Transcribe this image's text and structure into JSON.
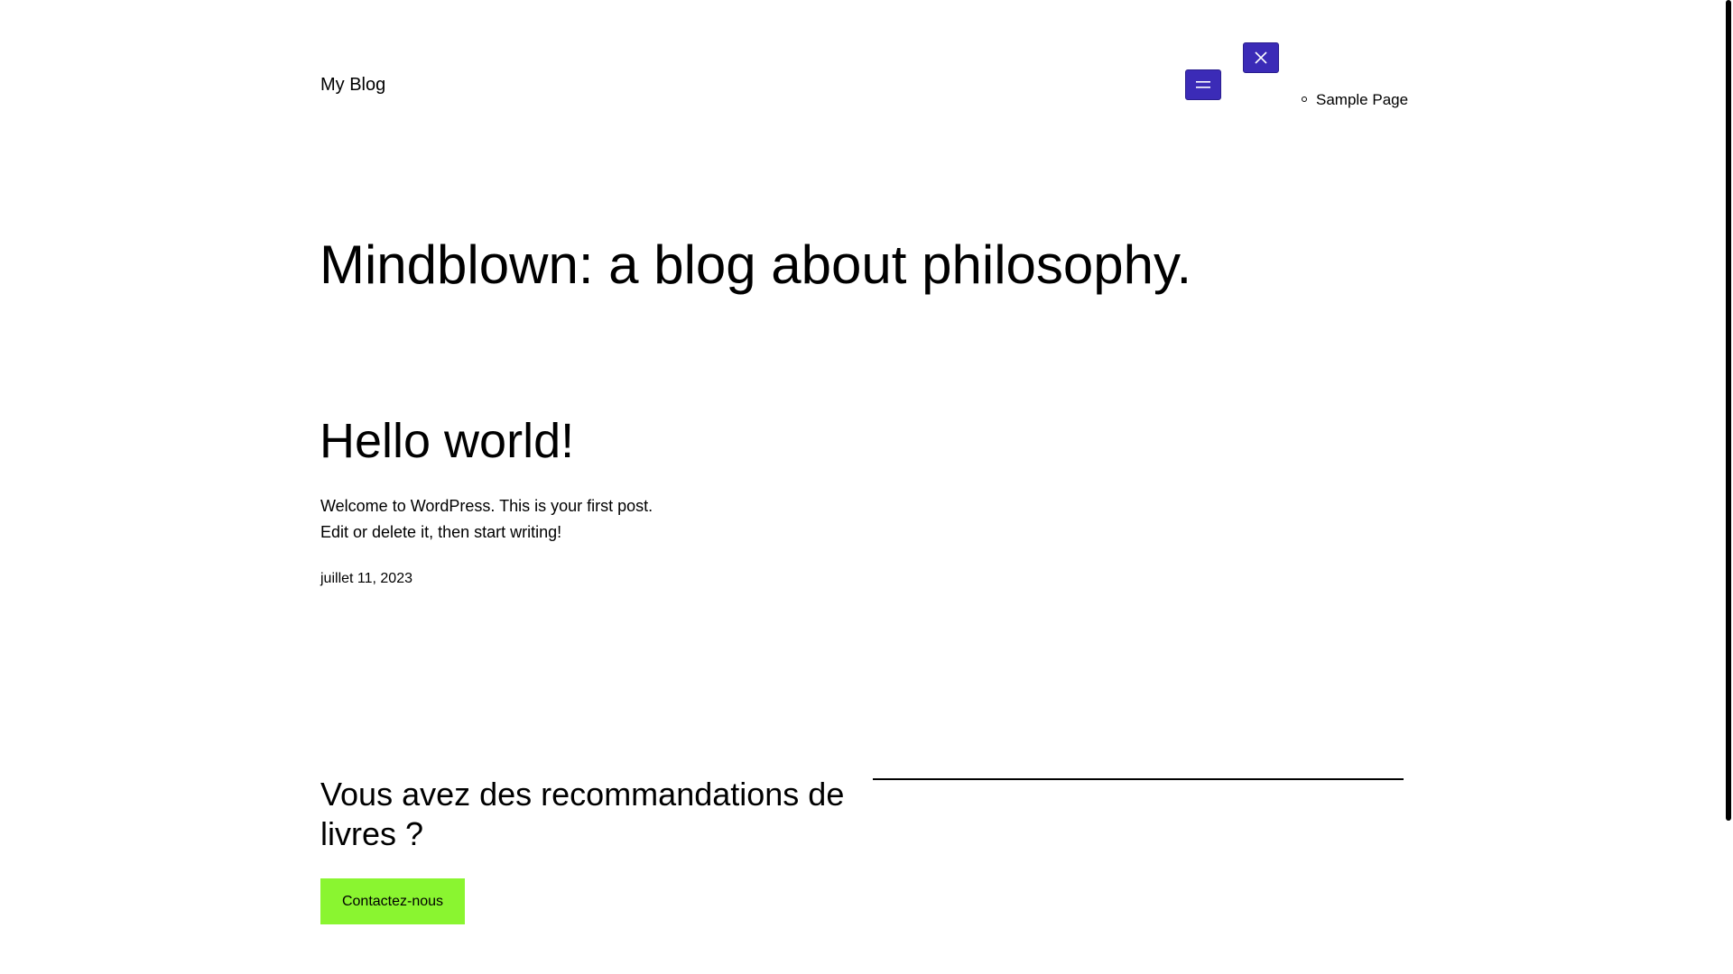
{
  "header": {
    "site_title": "My Blog",
    "menu_open_icon": "hamburger-icon",
    "menu_close_icon": "close-icon",
    "nav_items": [
      {
        "label": "Sample Page"
      }
    ]
  },
  "hero": {
    "title": "Mindblown: a blog about philosophy."
  },
  "post": {
    "title": "Hello world!",
    "excerpt_line1": "Welcome to WordPress. This is your first post.",
    "excerpt_line2": "Edit or delete it, then start writing!",
    "date": "juillet 11, 2023"
  },
  "cta": {
    "heading": "Vous avez des recommandations de livres ?",
    "button_label": "Contactez-nous"
  },
  "colors": {
    "accent_button": "#3b2bb7",
    "cta_button": "#8af530",
    "text": "#000000",
    "background": "#ffffff"
  }
}
